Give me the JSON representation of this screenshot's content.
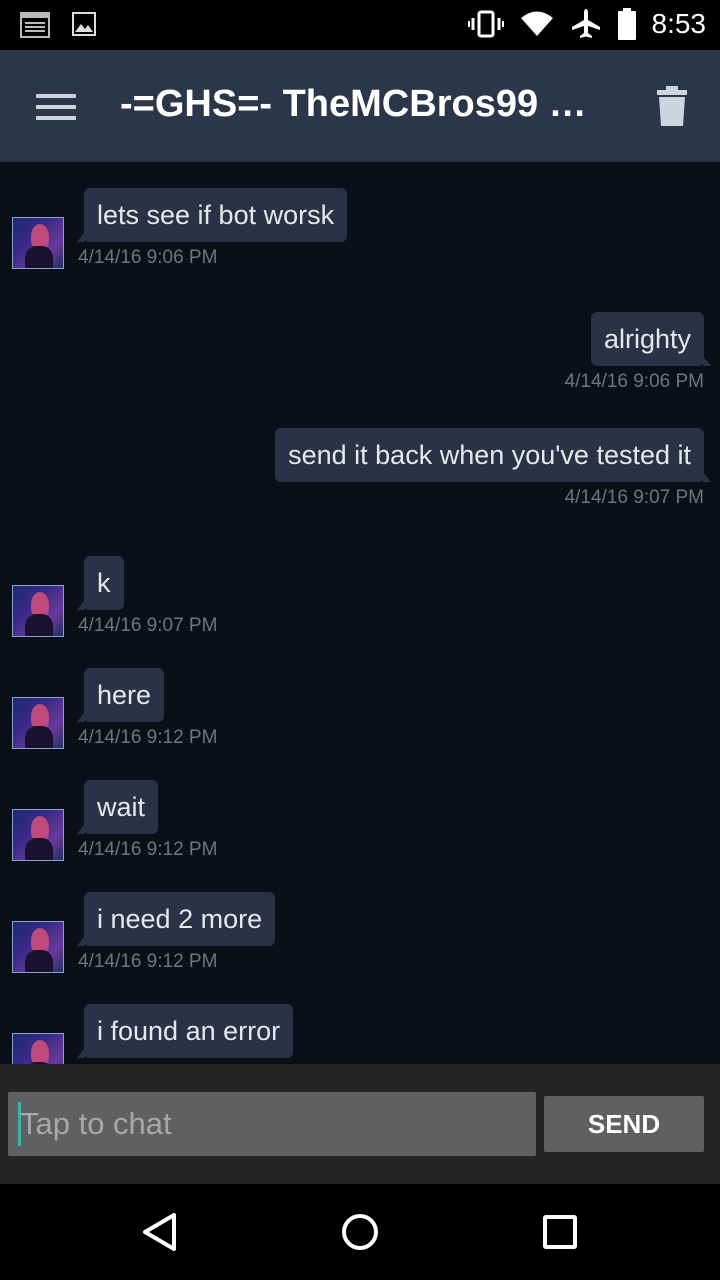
{
  "status_bar": {
    "time": "8:53",
    "icons": [
      "notes-icon",
      "image-icon",
      "vibrate-icon",
      "wifi-icon",
      "airplane-icon",
      "battery-icon"
    ]
  },
  "app_bar": {
    "title": "-=GHS=- TheMCBros99 #...",
    "menu_icon": "hamburger-menu-icon",
    "trash_icon": "trash-icon"
  },
  "messages": [
    {
      "direction": "in",
      "text": "lets see if bot worsk",
      "time": "4/14/16 9:06 PM"
    },
    {
      "direction": "out",
      "text": "alrighty",
      "time": "4/14/16 9:06 PM"
    },
    {
      "direction": "out",
      "text": "send it back when you've tested it",
      "time": "4/14/16 9:07 PM"
    },
    {
      "direction": "in",
      "text": "k",
      "time": "4/14/16 9:07 PM"
    },
    {
      "direction": "in",
      "text": "here",
      "time": "4/14/16 9:12 PM"
    },
    {
      "direction": "in",
      "text": "wait",
      "time": "4/14/16 9:12 PM"
    },
    {
      "direction": "in",
      "text": "i need 2 more",
      "time": "4/14/16 9:12 PM"
    },
    {
      "direction": "in",
      "text": "i found an error",
      "time": ""
    }
  ],
  "input": {
    "placeholder": "Tap to chat",
    "value": "",
    "send_label": "SEND"
  },
  "nav_bar": {
    "back_icon": "back-triangle-icon",
    "home_icon": "home-circle-icon",
    "recents_icon": "recents-square-icon"
  },
  "colors": {
    "app_bar": "#2b3649",
    "chat_background": "#0b0f18",
    "bubble": "#2b3246",
    "timestamp": "#6e7480",
    "input_bar": "#232426",
    "accent_caret": "#3fb3a6"
  }
}
